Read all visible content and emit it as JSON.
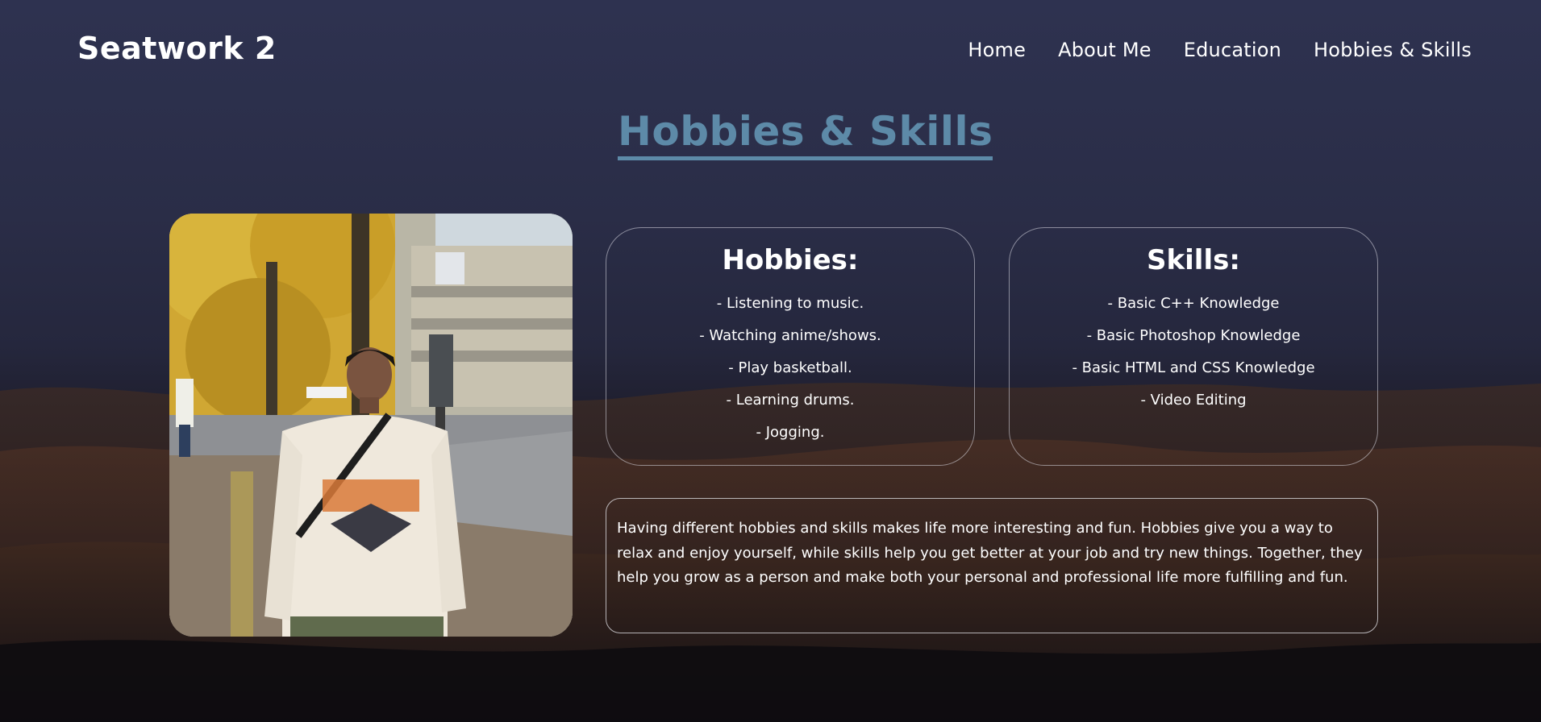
{
  "header": {
    "brand": "Seatwork 2",
    "nav": [
      "Home",
      "About Me",
      "Education",
      "Hobbies & Skills"
    ]
  },
  "page_title": "Hobbies & Skills",
  "hobbies": {
    "title": "Hobbies:",
    "items": [
      "- Listening to music.",
      "- Watching anime/shows.",
      "- Play basketball.",
      "- Learning drums.",
      "- Jogging."
    ]
  },
  "skills": {
    "title": "Skills:",
    "items": [
      "- Basic C++ Knowledge",
      "- Basic Photoshop Knowledge",
      "- Basic HTML and CSS Knowledge",
      "- Video Editing"
    ]
  },
  "description": "Having different hobbies and skills makes life more interesting and fun. Hobbies give you a way to relax and enjoy yourself, while skills help you get better at your job and try new things. Together, they help you grow as a person and make both your personal and professional life more fulfilling and fun.",
  "colors": {
    "title_accent": "#5d8aa8",
    "background_top": "#2e3250",
    "background_bottom": "#0f0e14"
  }
}
